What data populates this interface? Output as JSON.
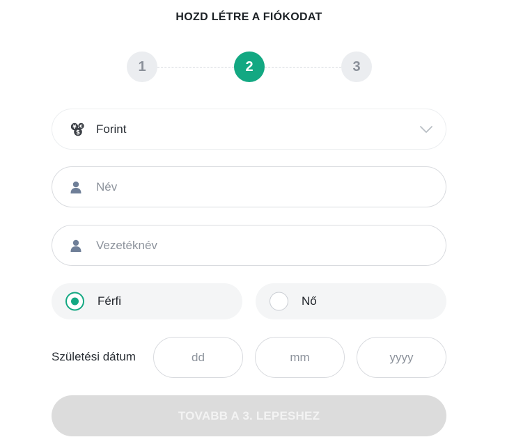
{
  "title": "HOZD LÉTRE A FIÓKODAT",
  "stepper": {
    "steps": [
      {
        "number": "1",
        "state": "inactive"
      },
      {
        "number": "2",
        "state": "active"
      },
      {
        "number": "3",
        "state": "inactive"
      }
    ],
    "colors": {
      "active": "#13a882",
      "inactive": "#ebedf0"
    }
  },
  "currency": {
    "value": "Forint",
    "icon": "currency-coins-icon"
  },
  "first_name": {
    "placeholder": "Név",
    "icon": "user-icon"
  },
  "last_name": {
    "placeholder": "Vezetéknév",
    "icon": "user-icon"
  },
  "gender": {
    "options": [
      {
        "label": "Férfi",
        "selected": true
      },
      {
        "label": "Nő",
        "selected": false
      }
    ]
  },
  "birth_date": {
    "label": "Születési dátum",
    "day_placeholder": "dd",
    "month_placeholder": "mm",
    "year_placeholder": "yyyy"
  },
  "next_button": {
    "label": "TOVABB A 3. LEPESHEZ",
    "enabled": false
  }
}
